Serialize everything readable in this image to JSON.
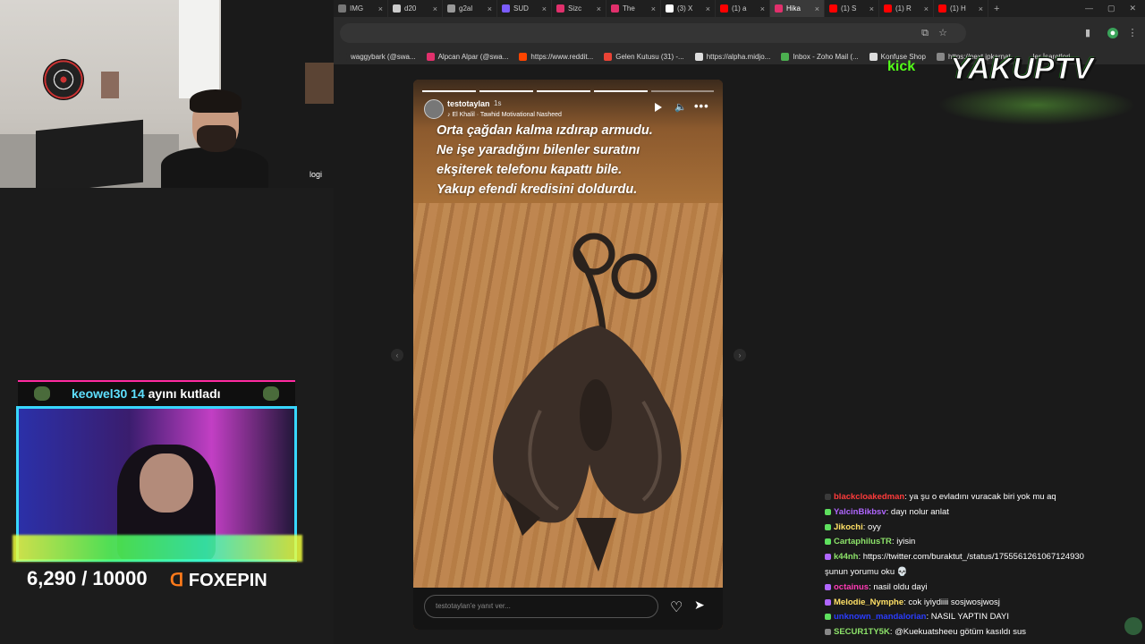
{
  "browser": {
    "tabs": [
      {
        "label": "IMG",
        "color": "#777777"
      },
      {
        "label": "d20",
        "color": "#cccccc"
      },
      {
        "label": "g2al",
        "color": "#999999"
      },
      {
        "label": "SUD",
        "color": "#7b5cff"
      },
      {
        "label": "Sizc",
        "color": "#e1306c"
      },
      {
        "label": "The",
        "color": "#e1306c"
      },
      {
        "label": "(3) X",
        "color": "#ffffff"
      },
      {
        "label": "(1) a",
        "color": "#ff0000"
      },
      {
        "label": "Hika",
        "color": "#e1306c",
        "active": true
      },
      {
        "label": "(1) S",
        "color": "#ff0000"
      },
      {
        "label": "(1) R",
        "color": "#ff0000"
      },
      {
        "label": "(1) H",
        "color": "#ff0000"
      }
    ],
    "new_tab": "+",
    "bookmarks": [
      {
        "label": "waggybark (@swa...",
        "color": "#2b2b2b"
      },
      {
        "label": "Alpcan Alpar (@swa...",
        "color": "#e1306c"
      },
      {
        "label": "https://www.reddit...",
        "color": "#ff4500"
      },
      {
        "label": "Gelen Kutusu (31) -...",
        "color": "#ea4335"
      },
      {
        "label": "https://alpha.midjo...",
        "color": "#dddddd"
      },
      {
        "label": "Inbox - Zoho Mail (...",
        "color": "#4caf50"
      },
      {
        "label": "Konfuse Shop",
        "color": "#dddddd"
      },
      {
        "label": "https://next.jpkarnat",
        "color": "#888888"
      },
      {
        "label": "ler İşaretleri",
        "color": "#2b2b2b"
      }
    ]
  },
  "webcam": {
    "tag": "logi"
  },
  "story": {
    "username": "testotaylan",
    "time_ago": "1s",
    "music": "El Khalil · Tawhid Motivational Nasheed",
    "caption_lines": [
      "Orta çağdan kalma ızdırap armudu.",
      "Ne işe yaradığını bilenler suratını",
      "ekşiterek telefonu kapattı bile.",
      "Yakup efendi kredisini doldurdu."
    ],
    "reply_placeholder": "testotaylan'e yanıt ver...",
    "progress_segments": 5,
    "progress_done": 4,
    "more": "•••"
  },
  "overlay": {
    "brand": "YAKUPTV",
    "kick": "kick"
  },
  "donation": {
    "celebrant": "keowel30",
    "months": "14",
    "text": "ayını kutladı",
    "goal_current": "6,290",
    "goal_total": "/ 10000",
    "sponsor": "FOXEPIN"
  },
  "chat": [
    {
      "user": "blackcloakedman",
      "color": "#ff3b3b",
      "badge": "#3a3a3a",
      "text": "ya şu o evladını vuracak biri yok mu aq"
    },
    {
      "user": "YalcinBikbsv",
      "color": "#b066ff",
      "badge": "#5ee05e",
      "text": "dayı nolur anlat"
    },
    {
      "user": "Jikochi",
      "color": "#ffe066",
      "badge": "#5ee05e",
      "text": "oyy"
    },
    {
      "user": "CartaphilusTR",
      "color": "#8de36a",
      "badge": "#5ee05e",
      "text": "iyisin"
    },
    {
      "user": "k44nh",
      "color": "#8de36a",
      "badge": "#b066ff",
      "text": "https://twitter.com/buraktut_/status/1755561261067124930"
    },
    {
      "user": "",
      "color": "#ffffff",
      "badge": "",
      "text": "şunun yorumu oku 💀"
    },
    {
      "user": "octainus",
      "color": "#ff3bb5",
      "badge": "#b066ff",
      "text": "nasil oldu dayi"
    },
    {
      "user": "Melodie_Nymphe",
      "color": "#ffe066",
      "badge": "#b066ff",
      "text": "cok iyiydiiii sosjwosjwosj"
    },
    {
      "user": "unknown_mandalorian",
      "color": "#2a3cff",
      "badge": "#5ee05e",
      "text": "NASIL YAPTIN DAYI"
    },
    {
      "user": "SECUR1TY5K",
      "color": "#8de36a",
      "badge": "#888888",
      "text": "@Kuekuatsheeu götüm kasıldı sus"
    }
  ]
}
